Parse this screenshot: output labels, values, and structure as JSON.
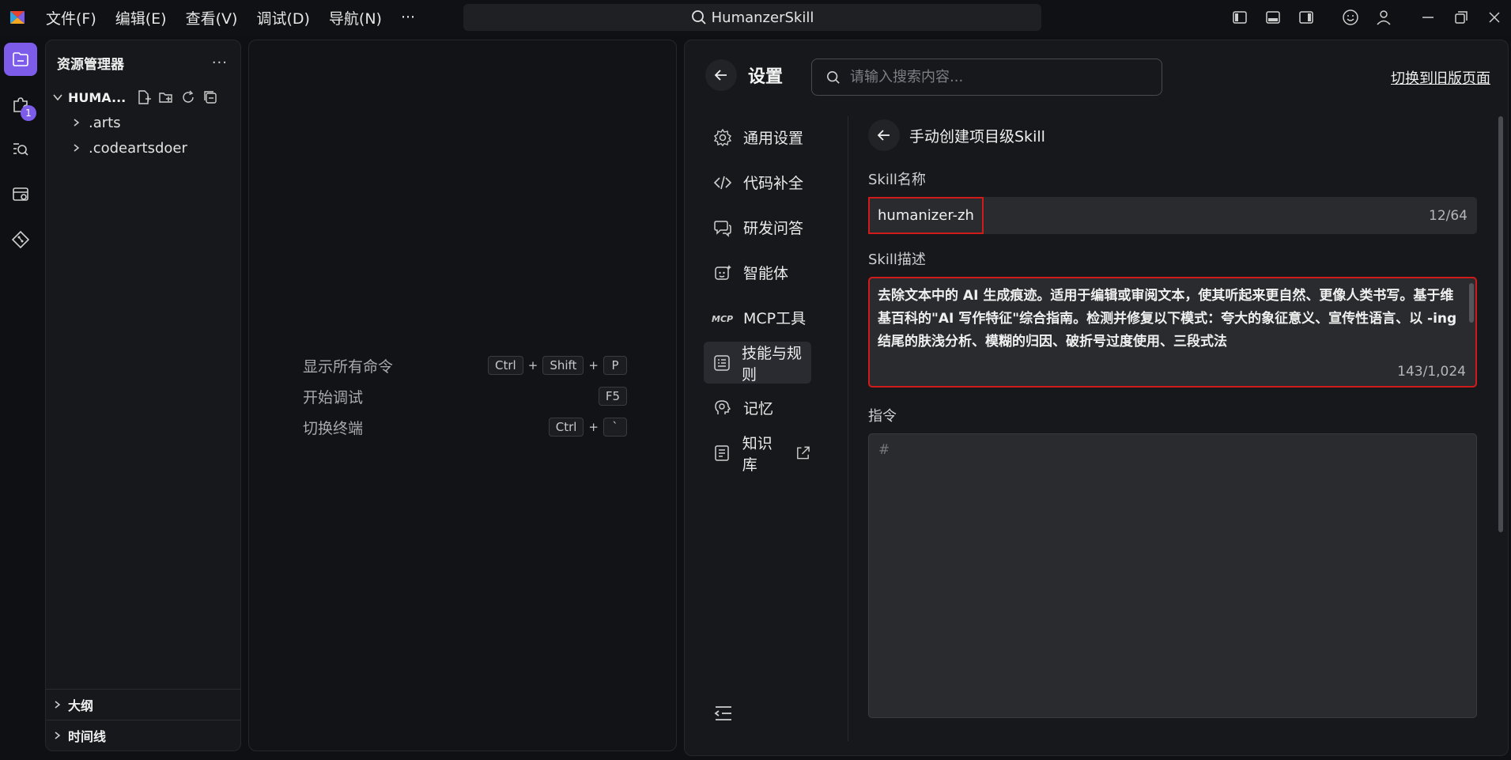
{
  "titlebar": {
    "menu": [
      "文件(F)",
      "编辑(E)",
      "查看(V)",
      "调试(D)",
      "导航(N)",
      "···"
    ],
    "search_text": "HumanzerSkill"
  },
  "activity": {
    "extension_badge": "1"
  },
  "explorer": {
    "title": "资源管理器",
    "more": "···",
    "project": "HUMA...",
    "items": [
      ".arts",
      ".codeartsdoer"
    ],
    "sections": [
      "大纲",
      "时间线"
    ]
  },
  "editor": {
    "commands": [
      {
        "label": "显示所有命令",
        "keys": [
          "Ctrl",
          "Shift",
          "P"
        ]
      },
      {
        "label": "开始调试",
        "keys": [
          "F5"
        ]
      },
      {
        "label": "切换终端",
        "keys": [
          "Ctrl",
          "`"
        ]
      }
    ]
  },
  "settings": {
    "title": "设置",
    "search_placeholder": "请输入搜索内容...",
    "old_page_link": "切换到旧版页面",
    "nav": [
      {
        "label": "通用设置",
        "icon": "gear-icon"
      },
      {
        "label": "代码补全",
        "icon": "code-icon"
      },
      {
        "label": "研发问答",
        "icon": "chat-icon"
      },
      {
        "label": "智能体",
        "icon": "agent-icon"
      },
      {
        "label": "MCP工具",
        "icon": "mcp-icon"
      },
      {
        "label": "技能与规则",
        "icon": "skill-icon",
        "active": true
      },
      {
        "label": "记忆",
        "icon": "memory-icon"
      },
      {
        "label": "知识库",
        "icon": "book-icon"
      }
    ],
    "form": {
      "subtitle": "手动创建项目级Skill",
      "name_label": "Skill名称",
      "name_value": "humanizer-zh",
      "name_counter": "12/64",
      "desc_label": "Skill描述",
      "desc_value": "去除文本中的 AI 生成痕迹。适用于编辑或审阅文本，使其听起来更自然、更像人类书写。基于维基百科的\"AI 写作特征\"综合指南。检测并修复以下模式：夸大的象征意义、宣传性语言、以 -ing 结尾的肤浅分析、模糊的归因、破折号过度使用、三段式法",
      "desc_counter": "143/1,024",
      "instruction_label": "指令",
      "instruction_placeholder": "#"
    }
  },
  "colors": {
    "accent": "#7c5ce8",
    "highlight": "#d11a1a"
  }
}
